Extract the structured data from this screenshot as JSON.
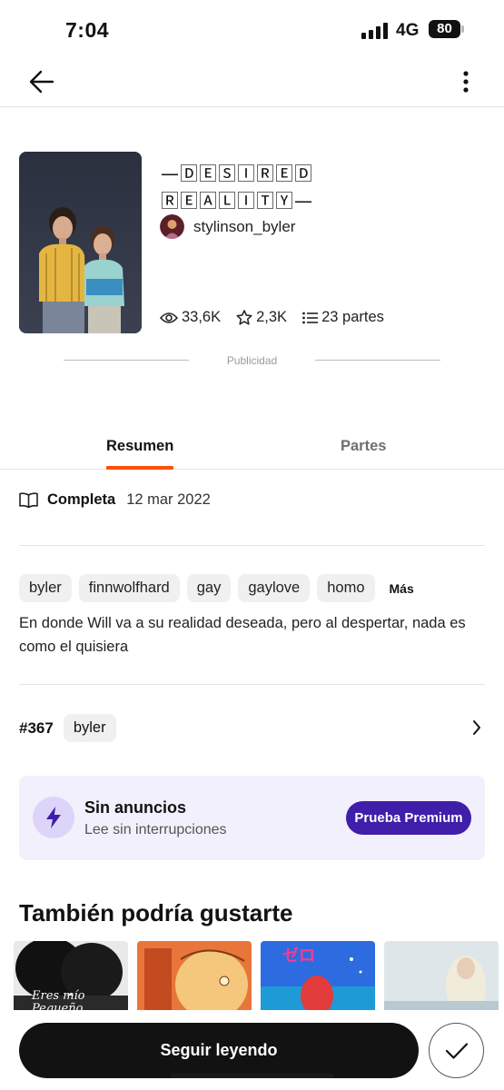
{
  "status_bar": {
    "time": "7:04",
    "network": "4G",
    "battery": "80"
  },
  "story": {
    "title_line1": "—🄳🄴🅂🄸🅁🄴🄳",
    "title_line2": "🅁🄴🄰🄻🄸🅃🅈—",
    "author": "stylinson_byler",
    "reads": "33,6K",
    "votes": "2,3K",
    "parts": "23 partes"
  },
  "ad": {
    "label": "Publicidad"
  },
  "tabs": [
    {
      "label": "Resumen"
    },
    {
      "label": "Partes"
    }
  ],
  "details": {
    "status": "Completa",
    "date": "12 mar 2022"
  },
  "tags": [
    "byler",
    "finnwolfhard",
    "gay",
    "gaylove",
    "homo"
  ],
  "tags_more": "Más",
  "description": "En donde Will va a su realidad deseada, pero al despertar, nada es como el quisiera",
  "ranking": {
    "number": "#367",
    "tag": "byler"
  },
  "premium": {
    "title": "Sin anuncios",
    "subtitle": "Lee sin interrupciones",
    "button": "Prueba Premium"
  },
  "recommendations": {
    "title": "También podría gustarte",
    "cards": [
      {
        "caption": "Eres mío Pequeño"
      },
      {
        "caption": ""
      },
      {
        "caption": ""
      },
      {
        "caption": ""
      }
    ]
  },
  "bottom": {
    "continue_label": "Seguir leyendo"
  },
  "colors": {
    "accent": "#ff500a",
    "premium": "#3f1fa9",
    "premium_bg": "#f3f0fd"
  }
}
